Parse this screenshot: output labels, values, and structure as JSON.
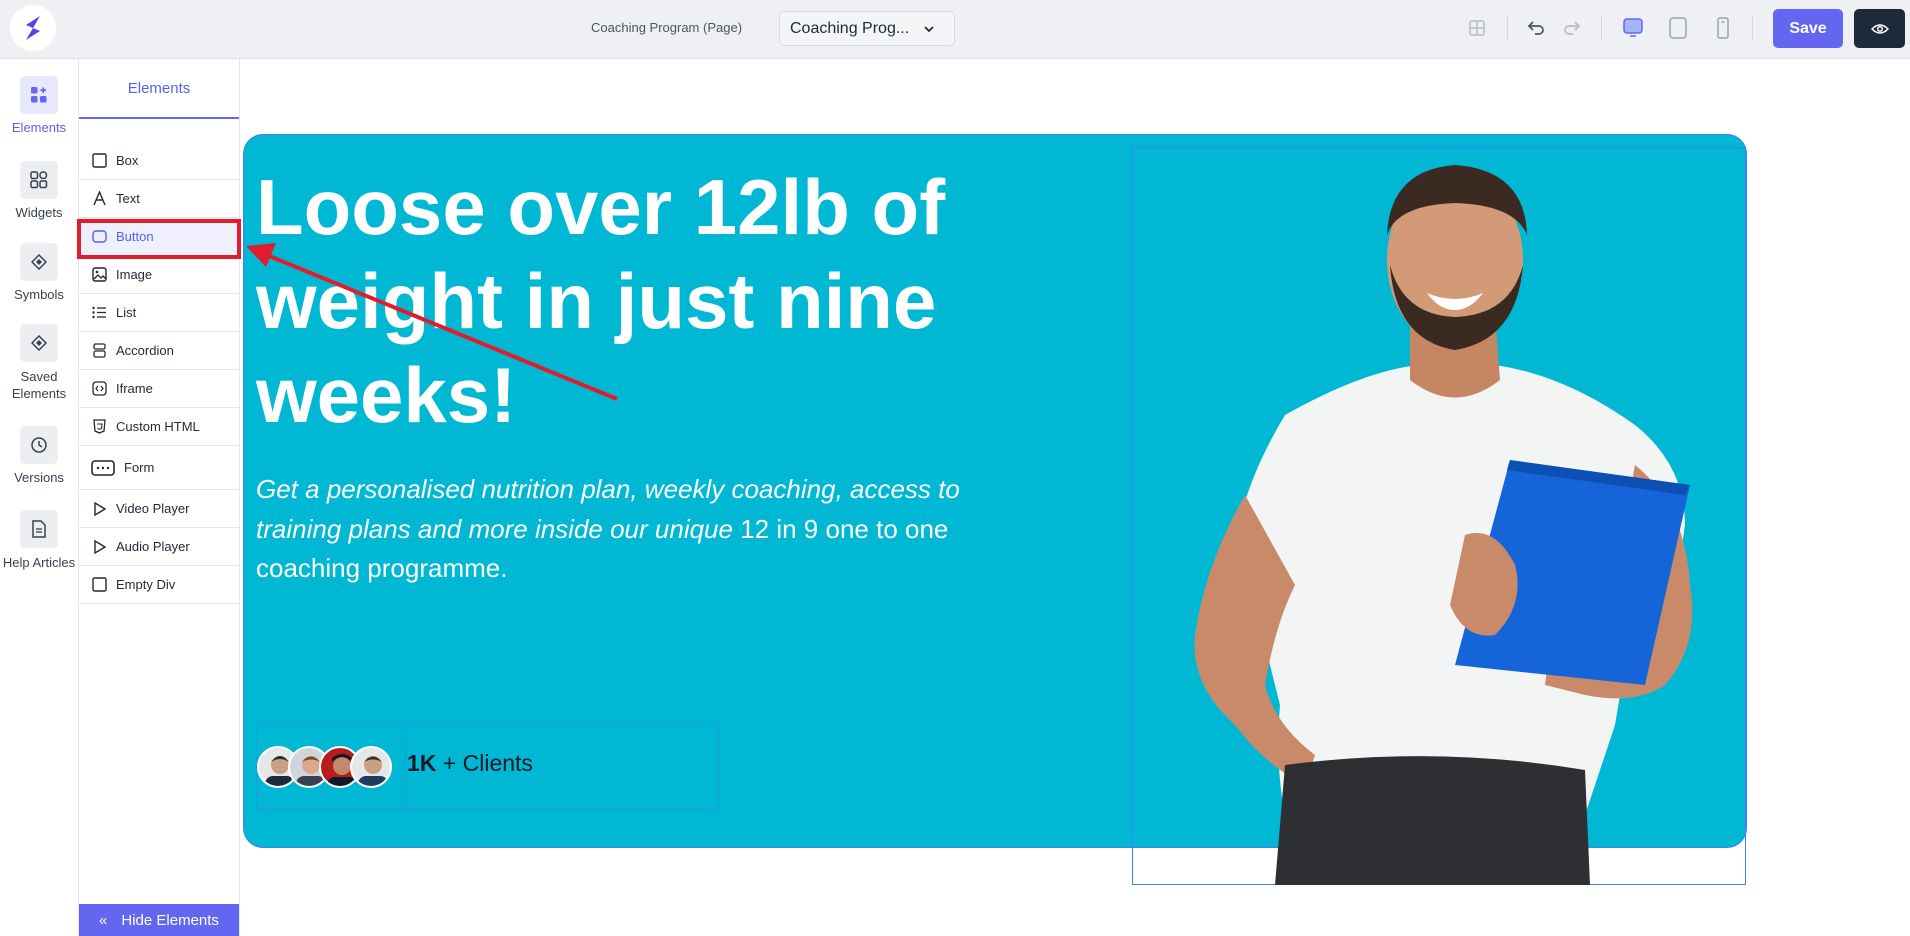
{
  "topbar": {
    "page_name": "Coaching Program (Page)",
    "page_select_value": "Coaching Prog...",
    "save_label": "Save"
  },
  "rail": {
    "items": [
      {
        "label": "Elements",
        "icon": "elements-icon"
      },
      {
        "label": "Widgets",
        "icon": "widgets-icon"
      },
      {
        "label": "Symbols",
        "icon": "symbols-icon"
      },
      {
        "label": "Saved Elements",
        "icon": "saved-elements-icon"
      },
      {
        "label": "Versions",
        "icon": "versions-icon"
      },
      {
        "label": "Help Articles",
        "icon": "help-articles-icon"
      }
    ]
  },
  "panel": {
    "title": "Elements",
    "items": [
      {
        "label": "Box",
        "icon": "box-icon"
      },
      {
        "label": "Text",
        "icon": "text-icon"
      },
      {
        "label": "Button",
        "icon": "button-icon"
      },
      {
        "label": "Image",
        "icon": "image-icon"
      },
      {
        "label": "List",
        "icon": "list-icon"
      },
      {
        "label": "Accordion",
        "icon": "accordion-icon"
      },
      {
        "label": "Iframe",
        "icon": "iframe-icon"
      },
      {
        "label": "Custom HTML",
        "icon": "custom-html-icon"
      },
      {
        "label": "Form",
        "icon": "form-icon"
      },
      {
        "label": "Video Player",
        "icon": "video-player-icon"
      },
      {
        "label": "Audio Player",
        "icon": "audio-player-icon"
      },
      {
        "label": "Empty Div",
        "icon": "empty-div-icon"
      }
    ],
    "hide_label": "Hide Elements"
  },
  "hero": {
    "headline": "Loose over 12lb of weight in just nine weeks!",
    "subtext_italic": "Get a personalised nutrition plan, weekly coaching, access to training plans and more inside our unique",
    "subtext_plain": " 12 in 9 one to one coaching programme.",
    "clients_count": "1K",
    "clients_label": " + Clients"
  },
  "colors": {
    "accent": "#6366f1",
    "hero_bg": "#00b8d4",
    "annotation": "#e11d2b"
  }
}
